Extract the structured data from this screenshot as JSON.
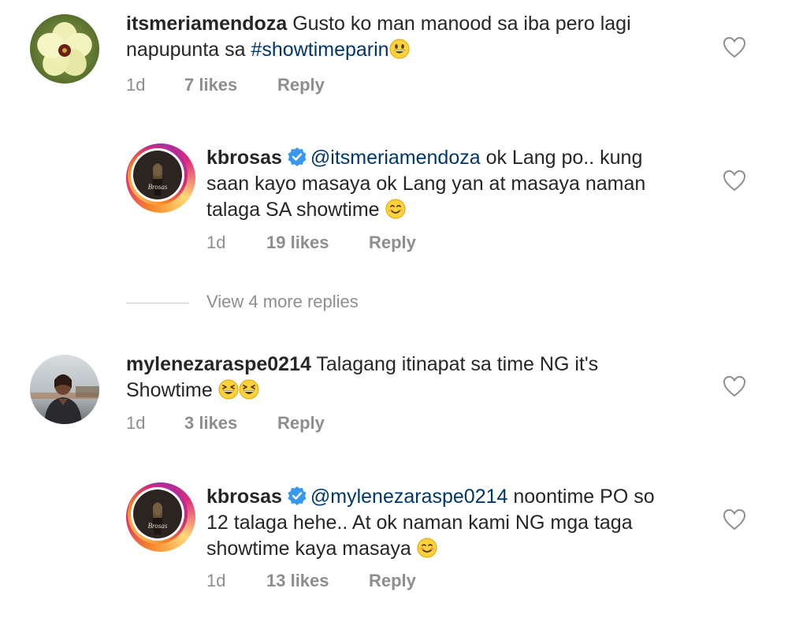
{
  "comments": [
    {
      "username": "itsmeriamendoza",
      "text_before": "Gusto ko man manood sa iba pero lagi",
      "text_line2": "napupunta sa ",
      "hashtag": "#showtimeparin",
      "emoji": "grinning-face-emoji",
      "age": "1d",
      "likes": "7 likes",
      "reply": "Reply"
    },
    {
      "username": "kbrosas",
      "mention": "@itsmeriamendoza",
      "text_line1": " ok Lang po.. kung",
      "text_line2": "saan kayo masaya ok Lang yan at masaya naman",
      "text_line3": "talaga SA showtime ",
      "emoji": "smiling-face-emoji",
      "age": "1d",
      "likes": "19 likes",
      "reply": "Reply"
    },
    {
      "view_more": "View 4 more replies"
    },
    {
      "username": "mylenezaraspe0214",
      "text_line1": " Talagang itinapat sa time NG it's",
      "text_line2": "Showtime ",
      "emoji": "laughing-face-emoji",
      "age": "1d",
      "likes": "3 likes",
      "reply": "Reply"
    },
    {
      "username": "kbrosas",
      "mention": "@mylenezaraspe0214",
      "text_line1": " noontime PO so",
      "text_line2": "12 talaga hehe.. At ok naman kami NG mga taga",
      "text_line3": "showtime kaya masaya ",
      "emoji": "blushing-face-emoji",
      "age": "1d",
      "likes": "13 likes",
      "reply": "Reply"
    }
  ],
  "avatar_text": "Brosas",
  "colors": {
    "text": "#262626",
    "link": "#00376b",
    "meta": "#8e8e8e",
    "verified": "#3897f0"
  }
}
